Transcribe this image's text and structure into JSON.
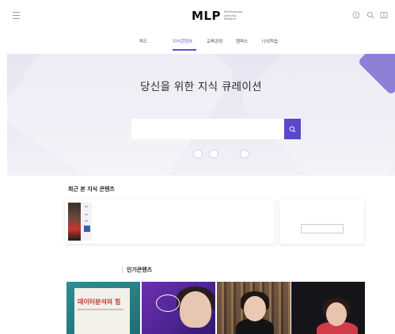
{
  "header": {
    "logo_text": "MLP",
    "logo_subtext": "Multicampus Learning Platform",
    "icons": [
      "menu-icon",
      "notification-icon",
      "search-icon",
      "bookmark-icon"
    ]
  },
  "nav": {
    "items": [
      {
        "label": "피드"
      },
      {
        "label": "지식콘텐츠"
      },
      {
        "label": "교육과정"
      },
      {
        "label": "캠퍼스"
      },
      {
        "label": "나의학습"
      }
    ],
    "active_index": 1
  },
  "hero": {
    "title": "당신을 위한 지식 큐레이션",
    "subtitle": "",
    "search_placeholder": "",
    "keywords_label": "",
    "keywords": [
      "",
      "",
      ""
    ]
  },
  "recent": {
    "title": "최근 본 지식 콘텐츠",
    "description": "",
    "item_title": "",
    "item_author": "",
    "more_text": "",
    "more_button": ""
  },
  "popular": {
    "prefix": "",
    "title": "인기콘텐츠",
    "cards": [
      {
        "title": "데이터분석의 힘",
        "bubble": "",
        "caption": "",
        "neon": ""
      },
      {
        "title": "",
        "bubble": "",
        "caption": "",
        "neon": ""
      },
      {
        "title": "",
        "bubble": "",
        "caption": "",
        "neon": ""
      },
      {
        "title": "",
        "bubble": "",
        "caption": "",
        "neon": ""
      }
    ]
  },
  "colors": {
    "accent": "#5948c9",
    "hero_background": "#e9e8f2",
    "active_nav": "#5e4dd6"
  }
}
